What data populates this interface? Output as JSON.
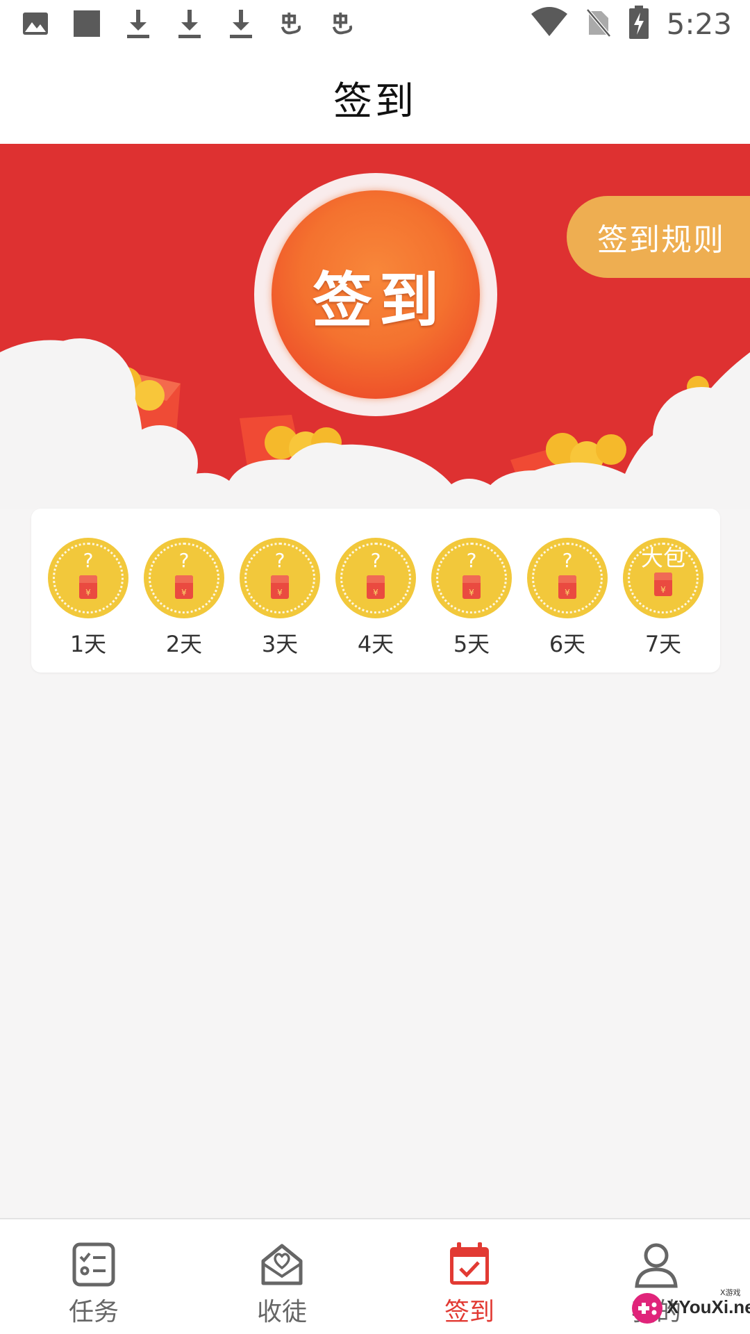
{
  "status_bar": {
    "time": "5:23",
    "left_icons": [
      "image-icon",
      "square-icon",
      "download-icon",
      "download-icon",
      "download-icon",
      "bug-icon",
      "bug-icon"
    ],
    "right_icons": [
      "wifi-icon",
      "no-sim-icon",
      "battery-charging-icon"
    ]
  },
  "header": {
    "title": "签到"
  },
  "hero": {
    "sign_in_label": "签到",
    "rules_label": "签到规则",
    "colors": {
      "background": "#de3131",
      "button": "#f4722f",
      "rules": "#eeae51"
    }
  },
  "days": [
    {
      "mark": "?",
      "label": "1天",
      "icon": "red-packet-icon"
    },
    {
      "mark": "?",
      "label": "2天",
      "icon": "red-packet-icon"
    },
    {
      "mark": "?",
      "label": "3天",
      "icon": "red-packet-icon"
    },
    {
      "mark": "?",
      "label": "4天",
      "icon": "red-packet-icon"
    },
    {
      "mark": "?",
      "label": "5天",
      "icon": "red-packet-icon"
    },
    {
      "mark": "?",
      "label": "6天",
      "icon": "red-packet-icon"
    },
    {
      "mark": "大包",
      "label": "7天",
      "icon": "red-packet-icon"
    }
  ],
  "packet_symbol": "¥",
  "bottom_nav": {
    "items": [
      {
        "label": "任务",
        "icon": "task-list-icon",
        "active": false
      },
      {
        "label": "收徒",
        "icon": "heart-envelope-icon",
        "active": false
      },
      {
        "label": "签到",
        "icon": "calendar-check-icon",
        "active": true
      },
      {
        "label": "我的",
        "icon": "user-icon",
        "active": false
      }
    ],
    "active_color": "#e23a33"
  },
  "watermark": {
    "text": "XYouXi.net",
    "small": "X游戏"
  }
}
